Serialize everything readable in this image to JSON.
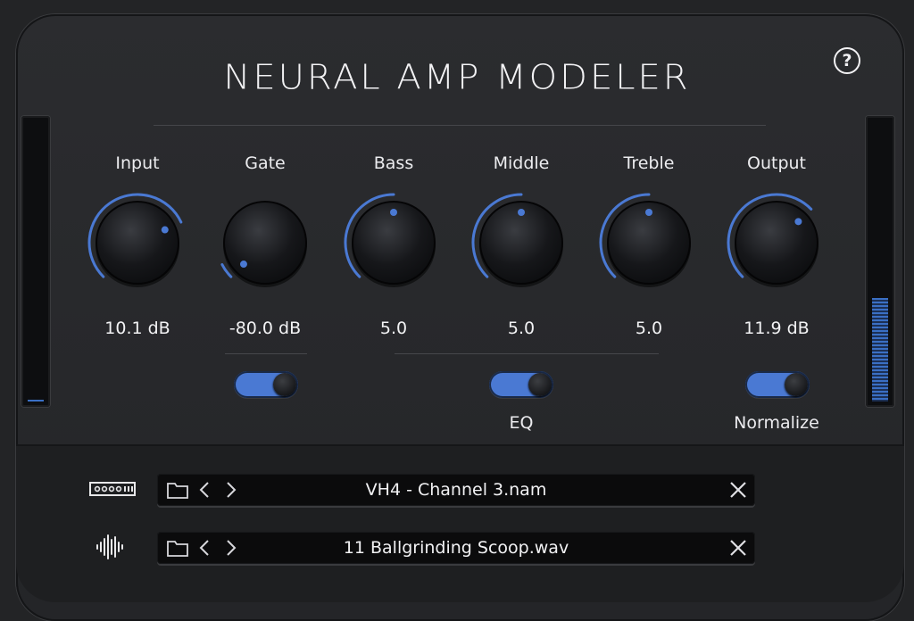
{
  "app": {
    "title": "NEURAL AMP MODELER",
    "help_label": "?"
  },
  "meters": {
    "input_level": 0.0,
    "output_level": 0.37,
    "accent": "#3a6fc4"
  },
  "knobs": [
    {
      "id": "input",
      "label": "Input",
      "value": "10.1 dB",
      "position": 0.74
    },
    {
      "id": "gate",
      "label": "Gate",
      "value": "-80.0 dB",
      "position": 0.0
    },
    {
      "id": "bass",
      "label": "Bass",
      "value": "5.0",
      "position": 0.5
    },
    {
      "id": "middle",
      "label": "Middle",
      "value": "5.0",
      "position": 0.5
    },
    {
      "id": "treble",
      "label": "Treble",
      "value": "5.0",
      "position": 0.5
    },
    {
      "id": "output",
      "label": "Output",
      "value": "11.9 dB",
      "position": 0.67
    }
  ],
  "toggles": {
    "gate": {
      "on": true,
      "label": ""
    },
    "eq": {
      "on": true,
      "label": "EQ"
    },
    "normalize": {
      "on": true,
      "label": "Normalize"
    }
  },
  "model_loader": {
    "icon": "amp-model-icon",
    "file": "VH4 - Channel 3.nam"
  },
  "ir_loader": {
    "icon": "waveform-icon",
    "file": "11 Ballgrinding Scoop.wav"
  },
  "colors": {
    "accent": "#4a79d3",
    "background": "#27282b"
  }
}
